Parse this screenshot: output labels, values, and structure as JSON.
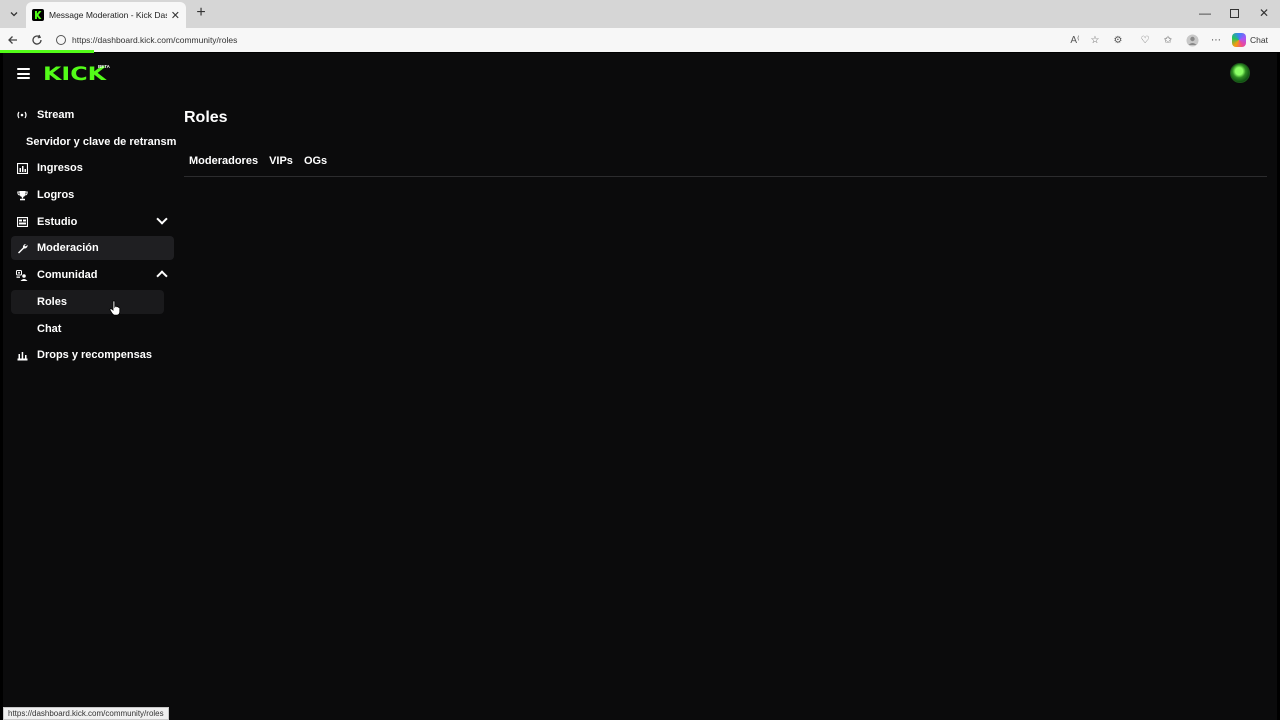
{
  "browser": {
    "tab_title": "Message Moderation - Kick Dashb",
    "url": "https://dashboard.kick.com/community/roles",
    "chat_label": "Chat",
    "status_url": "https://dashboard.kick.com/community/roles"
  },
  "header": {
    "logo": "KICK",
    "beta": "BETA"
  },
  "sidebar": {
    "items": [
      {
        "label": "Stream",
        "icon": "broadcast-icon"
      },
      {
        "label": "Servidor y clave de retransm",
        "icon": ""
      },
      {
        "label": "Ingresos",
        "icon": "chart-icon"
      },
      {
        "label": "Logros",
        "icon": "trophy-icon"
      },
      {
        "label": "Estudio",
        "icon": "studio-icon"
      },
      {
        "label": "Moderación",
        "icon": "wrench-icon"
      },
      {
        "label": "Comunidad",
        "icon": "community-icon"
      },
      {
        "label": "Roles",
        "icon": ""
      },
      {
        "label": "Chat",
        "icon": ""
      },
      {
        "label": "Drops y recompensas",
        "icon": "gift-icon"
      }
    ]
  },
  "main": {
    "title": "Roles",
    "tabs": [
      "Moderadores",
      "VIPs",
      "OGs"
    ]
  },
  "colors": {
    "accent": "#53fc18",
    "background": "#0b0b0c",
    "active_item": "#1f1f22"
  }
}
